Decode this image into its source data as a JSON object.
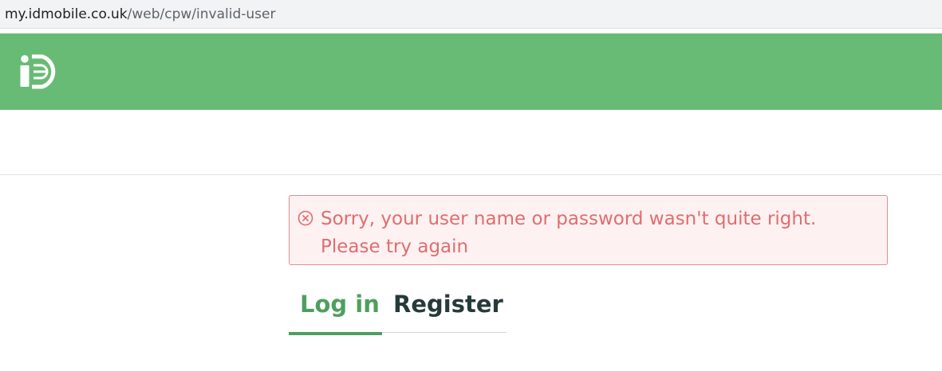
{
  "browser": {
    "url_host": "my.idmobile.co.uk",
    "url_path": "/web/cpw/invalid-user"
  },
  "header": {
    "logo_icon": "id-mobile-logo-icon",
    "background_color": "#68bb75"
  },
  "alert": {
    "icon": "error-circle-x-icon",
    "line1": "Sorry, your user name or password wasn't quite right.",
    "line2": "Please try again",
    "text_color": "#e06d70",
    "background_color": "#fdf1f1",
    "border_color": "#e48d90"
  },
  "tabs": {
    "items": [
      {
        "label": "Log in",
        "active": true
      },
      {
        "label": "Register",
        "active": false
      }
    ],
    "active_color": "#4e9f5f"
  }
}
